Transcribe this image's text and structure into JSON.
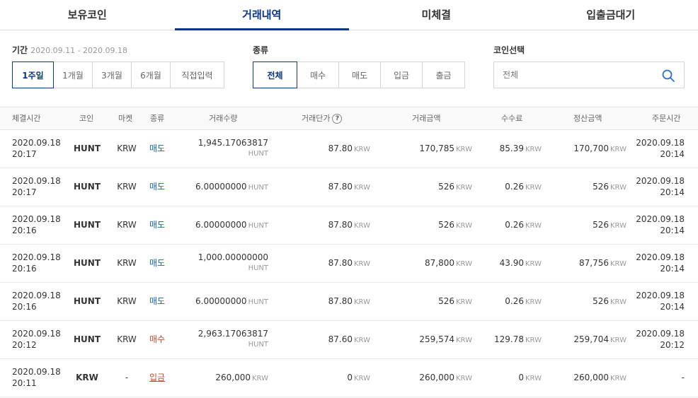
{
  "tabs": [
    {
      "label": "보유코인",
      "active": false
    },
    {
      "label": "거래내역",
      "active": true
    },
    {
      "label": "미체결",
      "active": false
    },
    {
      "label": "입출금대기",
      "active": false
    }
  ],
  "filters": {
    "period": {
      "label": "기간",
      "range": "2020.09.11 - 2020.09.18",
      "options": [
        "1주일",
        "1개월",
        "3개월",
        "6개월",
        "직접입력"
      ],
      "selected": "1주일"
    },
    "type": {
      "label": "종류",
      "options": [
        "전체",
        "매수",
        "매도",
        "입금",
        "출금"
      ],
      "selected": "전체"
    },
    "coin": {
      "label": "코인선택",
      "placeholder": "전체"
    }
  },
  "table": {
    "headers": [
      "체결시간",
      "코인",
      "마켓",
      "종류",
      "거래수량",
      "거래단가",
      "거래금액",
      "수수료",
      "정산금액",
      "주문시간"
    ],
    "rows": [
      {
        "time_date": "2020.09.18",
        "time_clock": "20:17",
        "coin": "HUNT",
        "market": "KRW",
        "type": "매도",
        "kind": "sell",
        "qty": "1,945.17063817",
        "qty_unit": "HUNT",
        "qty_wrap": true,
        "price": "87.80",
        "price_unit": "KRW",
        "amount": "170,785",
        "amount_unit": "KRW",
        "fee": "85.39",
        "fee_unit": "KRW",
        "settle": "170,700",
        "settle_unit": "KRW",
        "order_date": "2020.09.18",
        "order_clock": "20:14"
      },
      {
        "time_date": "2020.09.18",
        "time_clock": "20:17",
        "coin": "HUNT",
        "market": "KRW",
        "type": "매도",
        "kind": "sell",
        "qty": "6.00000000",
        "qty_unit": "HUNT",
        "qty_wrap": false,
        "price": "87.80",
        "price_unit": "KRW",
        "amount": "526",
        "amount_unit": "KRW",
        "fee": "0.26",
        "fee_unit": "KRW",
        "settle": "526",
        "settle_unit": "KRW",
        "order_date": "2020.09.18",
        "order_clock": "20:14"
      },
      {
        "time_date": "2020.09.18",
        "time_clock": "20:16",
        "coin": "HUNT",
        "market": "KRW",
        "type": "매도",
        "kind": "sell",
        "qty": "6.00000000",
        "qty_unit": "HUNT",
        "qty_wrap": false,
        "price": "87.80",
        "price_unit": "KRW",
        "amount": "526",
        "amount_unit": "KRW",
        "fee": "0.26",
        "fee_unit": "KRW",
        "settle": "526",
        "settle_unit": "KRW",
        "order_date": "2020.09.18",
        "order_clock": "20:14"
      },
      {
        "time_date": "2020.09.18",
        "time_clock": "20:16",
        "coin": "HUNT",
        "market": "KRW",
        "type": "매도",
        "kind": "sell",
        "qty": "1,000.00000000",
        "qty_unit": "HUNT",
        "qty_wrap": true,
        "price": "87.80",
        "price_unit": "KRW",
        "amount": "87,800",
        "amount_unit": "KRW",
        "fee": "43.90",
        "fee_unit": "KRW",
        "settle": "87,756",
        "settle_unit": "KRW",
        "order_date": "2020.09.18",
        "order_clock": "20:14"
      },
      {
        "time_date": "2020.09.18",
        "time_clock": "20:16",
        "coin": "HUNT",
        "market": "KRW",
        "type": "매도",
        "kind": "sell",
        "qty": "6.00000000",
        "qty_unit": "HUNT",
        "qty_wrap": false,
        "price": "87.80",
        "price_unit": "KRW",
        "amount": "526",
        "amount_unit": "KRW",
        "fee": "0.26",
        "fee_unit": "KRW",
        "settle": "526",
        "settle_unit": "KRW",
        "order_date": "2020.09.18",
        "order_clock": "20:14"
      },
      {
        "time_date": "2020.09.18",
        "time_clock": "20:12",
        "coin": "HUNT",
        "market": "KRW",
        "type": "매수",
        "kind": "buy",
        "qty": "2,963.17063817",
        "qty_unit": "HUNT",
        "qty_wrap": true,
        "price": "87.60",
        "price_unit": "KRW",
        "amount": "259,574",
        "amount_unit": "KRW",
        "fee": "129.78",
        "fee_unit": "KRW",
        "settle": "259,704",
        "settle_unit": "KRW",
        "order_date": "2020.09.18",
        "order_clock": "20:12"
      },
      {
        "time_date": "2020.09.18",
        "time_clock": "20:11",
        "coin": "KRW",
        "market": "-",
        "type": "입금",
        "kind": "deposit",
        "qty": "260,000",
        "qty_unit": "KRW",
        "qty_wrap": false,
        "price": "0",
        "price_unit": "KRW",
        "amount": "260,000",
        "amount_unit": "KRW",
        "fee": "0",
        "fee_unit": "KRW",
        "settle": "260,000",
        "settle_unit": "KRW",
        "order_date": "-",
        "order_clock": ""
      }
    ]
  },
  "colors": {
    "accent": "#093687",
    "sell": "#1261c4",
    "buy": "#c84a31"
  }
}
